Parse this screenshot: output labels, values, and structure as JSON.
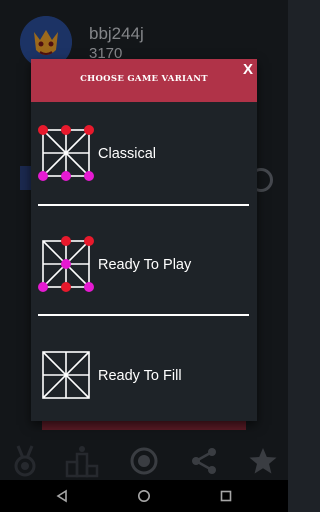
{
  "profile": {
    "username": "bbj244j",
    "score": "3170"
  },
  "dialog": {
    "title": "CHOOSE GAME VARIANT",
    "close_label": "X",
    "variants": [
      {
        "label": "Classical"
      },
      {
        "label": "Ready To Play"
      },
      {
        "label": "Ready To Fill"
      }
    ]
  },
  "colors": {
    "header": "#b03348",
    "dialog_bg": "#1e2328",
    "piece_red": "#e8192c",
    "piece_magenta": "#e61ad2"
  },
  "nav_icons": [
    "medal-icon",
    "podium-icon",
    "radio-target-icon",
    "share-icon",
    "star-icon"
  ],
  "system_icons": [
    "back-triangle-icon",
    "home-circle-icon",
    "recents-square-icon"
  ]
}
